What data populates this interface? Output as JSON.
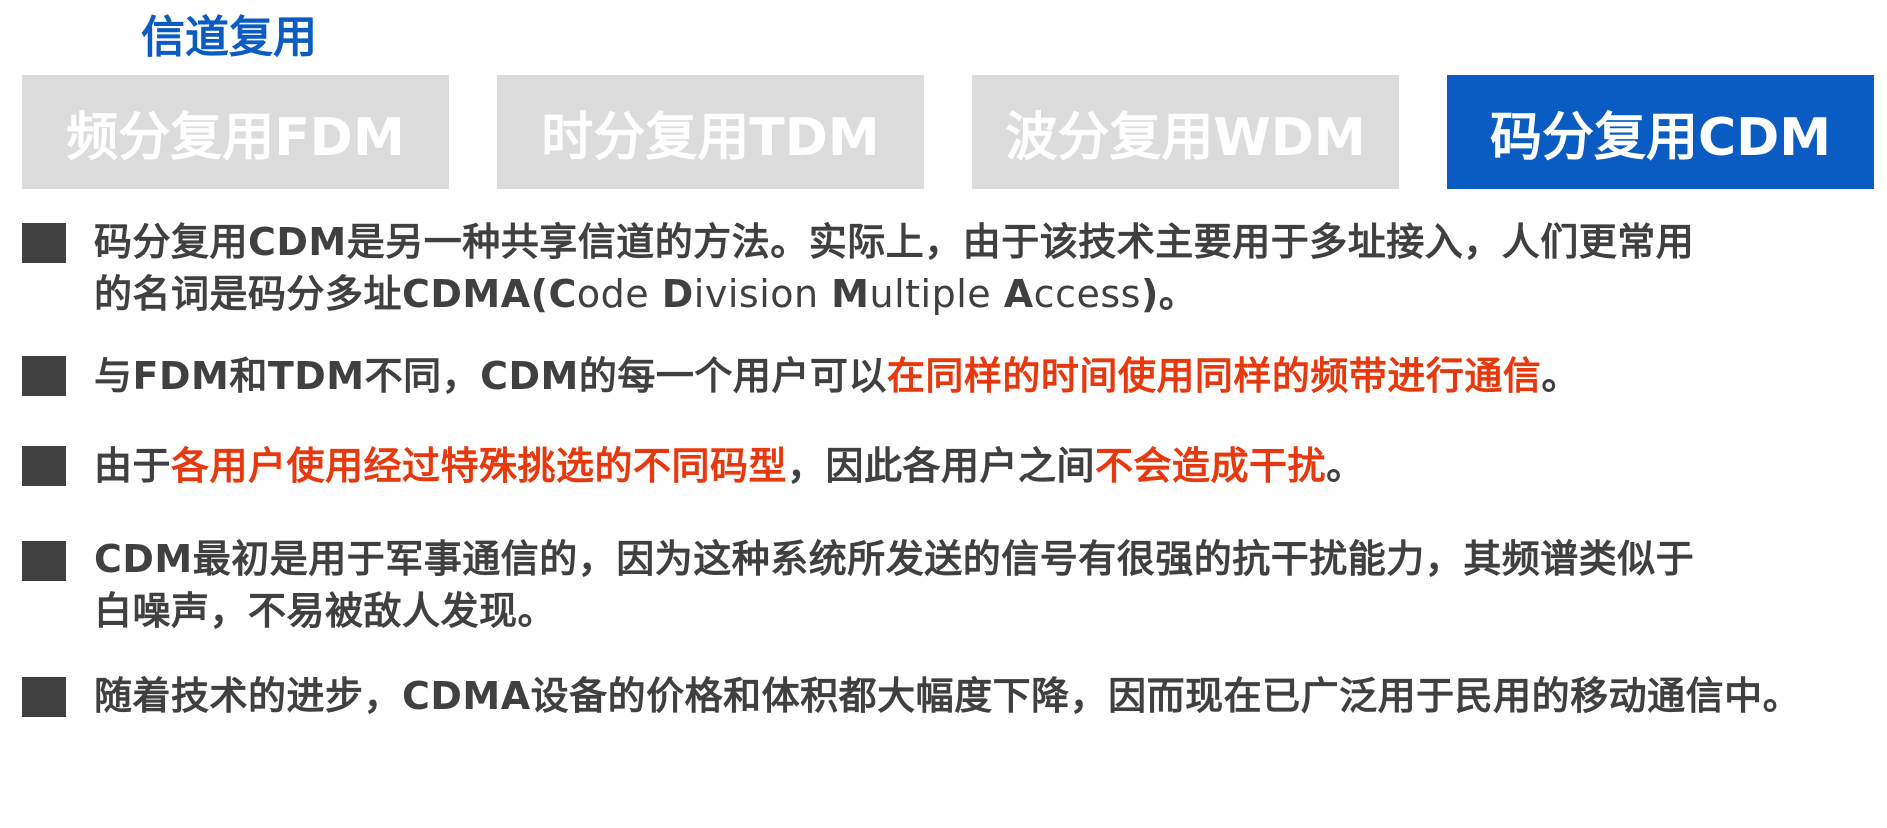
{
  "header": {
    "title": "信道复用"
  },
  "tabs": [
    {
      "label": "频分复用FDM",
      "active": false
    },
    {
      "label": "时分复用TDM",
      "active": false
    },
    {
      "label": "波分复用WDM",
      "active": false
    },
    {
      "label": "码分复用CDM",
      "active": true
    }
  ],
  "colors": {
    "accent": "#0a5cc2",
    "highlight_red": "#e8380d",
    "inactive_tab": "#dcdcdc",
    "body_text": "#404040"
  },
  "bullets": [
    {
      "p1_line1": "码分复用CDM是另一种共享信道的方法。实际上，由于该技术主要用于多址接入，人们更常用",
      "p1_line2_a": "的名词是码分多址CDMA(",
      "p1_C": "C",
      "p1_ode": "ode ",
      "p1_D": "D",
      "p1_ivision": "ivision ",
      "p1_M": "M",
      "p1_ultiple": "ultiple ",
      "p1_A": "A",
      "p1_ccess": "ccess",
      "p1_tail": ")。"
    },
    {
      "p2_a": "与FDM和TDM不同，CDM的每一个用户可以",
      "p2_red": "在同样的时间使用同样的频带进行通信",
      "p2_end": "。"
    },
    {
      "p3_a": "由于",
      "p3_red1": "各用户使用经过特殊挑选的不同码型",
      "p3_b": "，因此各用户之间",
      "p3_red2": "不会造成干扰",
      "p3_end": "。"
    },
    {
      "p4_line1": "CDM最初是用于军事通信的，因为这种系统所发送的信号有很强的抗干扰能力，其频谱类似于",
      "p4_line2": "白噪声，不易被敌人发现。"
    },
    {
      "p5": "随着技术的进步，CDMA设备的价格和体积都大幅度下降，因而现在已广泛用于民用的移动通信中。"
    }
  ]
}
